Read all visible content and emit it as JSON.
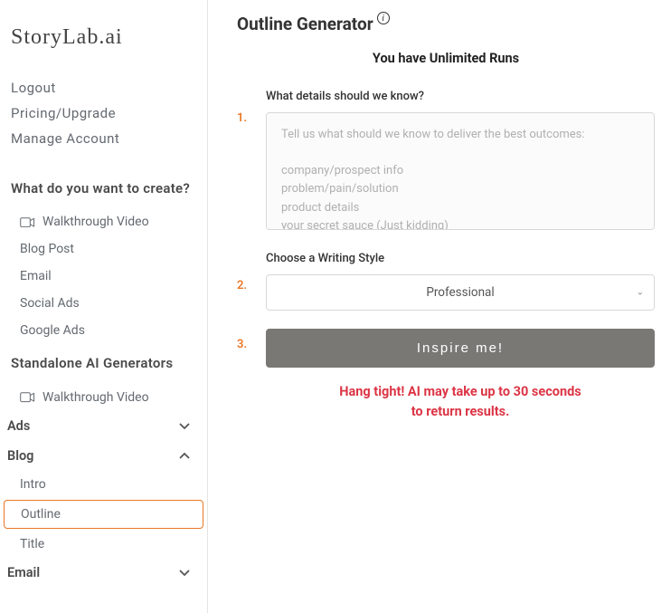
{
  "logo": "StoryLab.ai",
  "account_links": {
    "logout": "Logout",
    "pricing": "Pricing/Upgrade",
    "manage": "Manage Account"
  },
  "section_create": {
    "heading": "What do you want to create?",
    "items": {
      "walkthrough": "Walkthrough Video",
      "blog_post": "Blog Post",
      "email": "Email",
      "social_ads": "Social Ads",
      "google_ads": "Google Ads"
    }
  },
  "section_standalone": {
    "heading": "Standalone AI Generators",
    "walkthrough": "Walkthrough Video"
  },
  "accordions": {
    "ads": "Ads",
    "blog": "Blog",
    "email": "Email"
  },
  "blog_items": {
    "intro": "Intro",
    "outline": "Outline",
    "title": "Title"
  },
  "page": {
    "title": "Outline Generator",
    "runs": "You have Unlimited Runs"
  },
  "steps": {
    "s1": {
      "num": "1.",
      "label": "What details should we know?",
      "placeholder": "Tell us what should we know to deliver the best outcomes:\n\ncompany/prospect info\nproblem/pain/solution\nproduct details\nyour secret sauce (Just kidding)"
    },
    "s2": {
      "num": "2.",
      "label": "Choose a Writing Style",
      "value": "Professional"
    },
    "s3": {
      "num": "3.",
      "button": "Inspire me!"
    }
  },
  "wait_msg_line1": "Hang tight! AI may take up to 30 seconds",
  "wait_msg_line2": "to return results."
}
